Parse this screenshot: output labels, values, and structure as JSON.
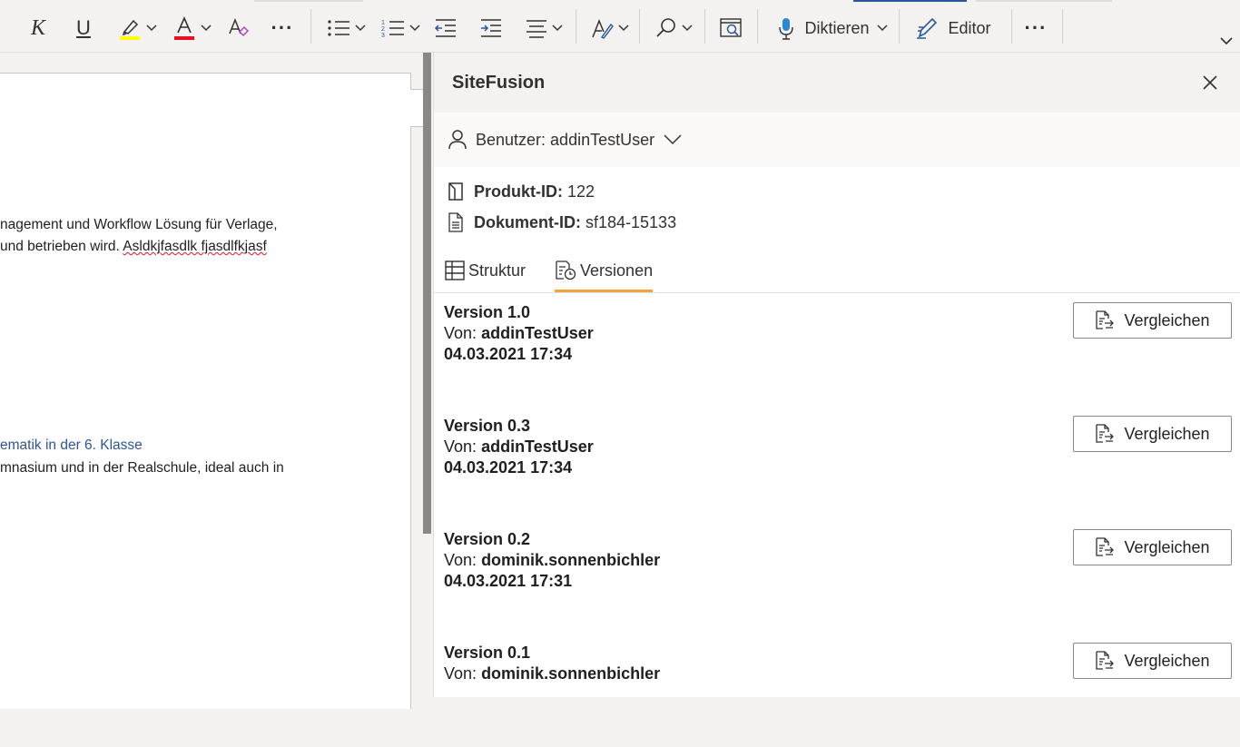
{
  "ribbon": {
    "italic_label": "K",
    "underline_label": "U",
    "more_label": "···",
    "dictate_label": "Diktieren",
    "editor_label": "Editor",
    "overflow_label": "···",
    "highlight_color": "#ffff00",
    "font_color": "#e81123"
  },
  "document": {
    "lines": [
      "nagement und Workflow Lösung für Verlage,",
      "und betrieben wird.",
      "Asldkjfasdlk fjasdlfkjasf",
      "ematik in der 6. Klasse",
      "mnasium und in der Realschule, ideal auch in"
    ],
    "link_color": "#2f5496"
  },
  "pane": {
    "title": "SiteFusion",
    "user_label": "Benutzer: addinTestUser",
    "product_label": "Produkt-ID:",
    "product_value": "122",
    "document_label": "Dokument-ID:",
    "document_value": "sf184-15133",
    "tabs": [
      {
        "label": "Struktur",
        "icon": "table-icon",
        "active": false
      },
      {
        "label": "Versionen",
        "icon": "version-history-icon",
        "active": true
      }
    ],
    "accent_color": "#f3a33a",
    "compare_label": "Vergleichen",
    "versions": [
      {
        "title": "Version 1.0",
        "by_label": "Von:",
        "user": "addinTestUser",
        "date": "04.03.2021 17:34"
      },
      {
        "title": "Version 0.3",
        "by_label": "Von:",
        "user": "addinTestUser",
        "date": "04.03.2021 17:34"
      },
      {
        "title": "Version 0.2",
        "by_label": "Von:",
        "user": "dominik.sonnenbichler",
        "date": "04.03.2021 17:31"
      },
      {
        "title": "Version 0.1",
        "by_label": "Von:",
        "user": "dominik.sonnenbichler",
        "date": ""
      }
    ]
  }
}
